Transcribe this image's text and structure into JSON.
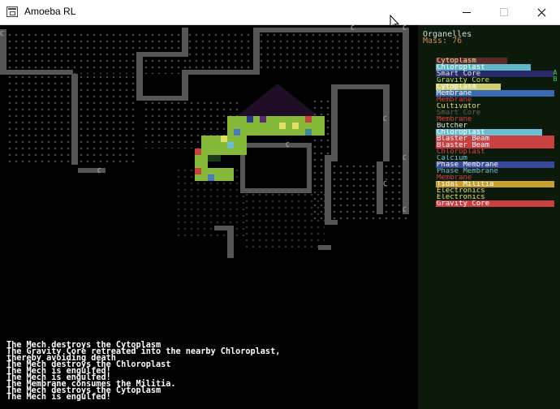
{
  "window": {
    "title": "Amoeba RL"
  },
  "panel": {
    "title": "Organelles",
    "mass_label": "Mass: 76",
    "organelles": [
      {
        "label": "Cytoplasm",
        "color": "#e6e6a0",
        "bar": "#5a2a2a",
        "fill": 0.6
      },
      {
        "label": "Chloroplast",
        "color": "#ffffff",
        "bar": "#5fb8c8",
        "fill": 0.8
      },
      {
        "label": "Smart Core",
        "color": "#e6e6e6",
        "bar": "#2a2a6a",
        "fill": 1.0
      },
      {
        "label": "Gravity Core",
        "color": "#bfe04a",
        "bar": "#000000",
        "fill": 0.0
      },
      {
        "label": "Cytoplasm",
        "color": "#ffffff",
        "bar": "#d0d070",
        "fill": 0.55
      },
      {
        "label": "Membrane",
        "color": "#ffffff",
        "bar": "#3a6ab0",
        "fill": 1.0
      },
      {
        "label": "Membrane",
        "color": "#d04040",
        "bar": "#000000",
        "fill": 0.0
      },
      {
        "label": "Cultivator",
        "color": "#e8e070",
        "bar": "#000000",
        "fill": 0.0
      },
      {
        "label": "Smart Core",
        "color": "#606060",
        "bar": "#000000",
        "fill": 0.0
      },
      {
        "label": "Membrane",
        "color": "#d04040",
        "bar": "#000000",
        "fill": 0.0
      },
      {
        "label": "Butcher",
        "color": "#e6e6e6",
        "bar": "#000000",
        "fill": 0.0
      },
      {
        "label": "Chloroplast",
        "color": "#ffffff",
        "bar": "#6ac0d0",
        "fill": 0.9
      },
      {
        "label": "Blaster Beam",
        "color": "#ffffff",
        "bar": "#c84040",
        "fill": 1.0
      },
      {
        "label": "Blaster Beam",
        "color": "#ffffff",
        "bar": "#c84040",
        "fill": 1.0
      },
      {
        "label": "Chloroplast",
        "color": "#e04040",
        "bar": "#000000",
        "fill": 0.0
      },
      {
        "label": "Calcium",
        "color": "#6ac0d0",
        "bar": "#000000",
        "fill": 0.0
      },
      {
        "label": "Phase Membrane",
        "color": "#ffffff",
        "bar": "#3a4a9a",
        "fill": 1.0
      },
      {
        "label": "Phase Membrane",
        "color": "#6ac0d0",
        "bar": "#000000",
        "fill": 0.0
      },
      {
        "label": "Membrane",
        "color": "#d04040",
        "bar": "#000000",
        "fill": 0.0
      },
      {
        "label": "Tidal Militia",
        "color": "#ffffff",
        "bar": "#c8a030",
        "fill": 1.0
      },
      {
        "label": "Electronics",
        "color": "#e8e070",
        "bar": "#000000",
        "fill": 0.0
      },
      {
        "label": "Electronics",
        "color": "#e8e070",
        "bar": "#000000",
        "fill": 0.0
      },
      {
        "label": "Gravity Core",
        "color": "#ffffff",
        "bar": "#c84040",
        "fill": 1.0
      }
    ],
    "side_marks": [
      "A",
      "B"
    ]
  },
  "log": [
    "The Mech destroys the Cytoplasm",
    "The Gravity Core retreated into the nearby Chloroplast,",
    "thereby avoiding death",
    "The Mech destroys the Chloroplast",
    "The Mech is engulfed!",
    "The Mech is engulfed!",
    "The Membrane consumes the Militia.",
    "The Mech destroys the Cytoplasm",
    "The Mech is engulfed!"
  ],
  "map": {
    "glyphs": [
      {
        "ch": "C",
        "color": "#bbbbbb"
      },
      {
        "ch": "C",
        "color": "#bbbbbb"
      },
      {
        "ch": "C",
        "color": "#bbbbbb"
      },
      {
        "ch": "C",
        "color": "#bbbbbb"
      },
      {
        "ch": "C",
        "color": "#bbbbbb"
      },
      {
        "ch": "C",
        "color": "#bbbbbb"
      },
      {
        "ch": "C",
        "color": "#bbbbbb"
      },
      {
        "ch": "C",
        "color": "#bbbbbb"
      },
      {
        "ch": "C",
        "color": "#bbbbbb"
      }
    ]
  }
}
